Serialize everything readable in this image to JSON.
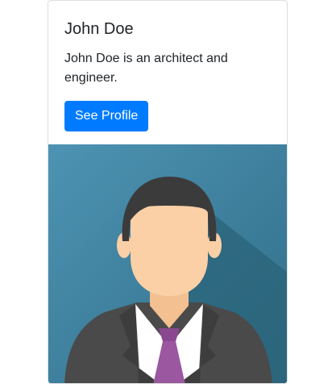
{
  "card": {
    "title": "John Doe",
    "text": "John Doe is an architect and engineer.",
    "button_label": "See Profile",
    "image_icon": "person-avatar-illustration"
  },
  "colors": {
    "button": "#007bff",
    "image_background": "#3a7e9a",
    "shirt": "#ffffff",
    "tie": "#9b57a0",
    "suit": "#4a4a4a",
    "hair": "#3b3b3b",
    "skin": "#fbd0a6"
  }
}
